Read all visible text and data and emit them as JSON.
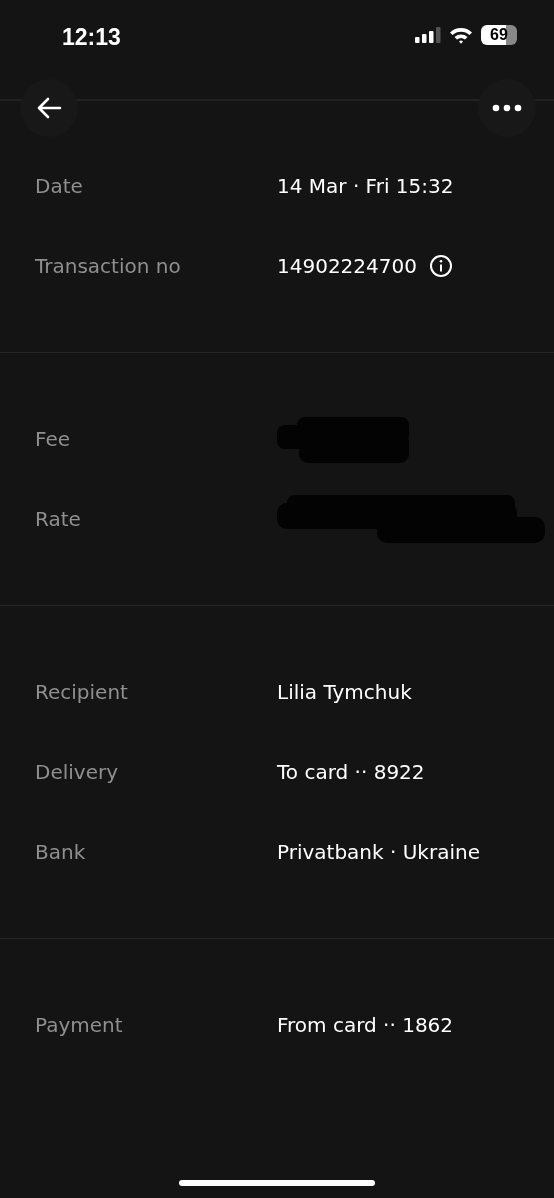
{
  "status_bar": {
    "time": "12:13",
    "battery": "69"
  },
  "sections": [
    {
      "rows": [
        {
          "kind": "text",
          "label": "Date",
          "value": "14 Mar · Fri 15:32"
        },
        {
          "kind": "info",
          "label": "Transaction no",
          "value": "14902224700"
        }
      ]
    },
    {
      "rows": [
        {
          "kind": "redacted",
          "label": "Fee"
        },
        {
          "kind": "redacted",
          "label": "Rate"
        }
      ]
    },
    {
      "rows": [
        {
          "kind": "text",
          "label": "Recipient",
          "value": "Lilia Tymchuk"
        },
        {
          "kind": "text",
          "label": "Delivery",
          "value": "To card ·· 8922"
        },
        {
          "kind": "text",
          "label": "Bank",
          "value": "Privatbank · Ukraine"
        }
      ]
    },
    {
      "rows": [
        {
          "kind": "text",
          "label": "Payment",
          "value": "From card ·· 1862"
        }
      ]
    }
  ]
}
